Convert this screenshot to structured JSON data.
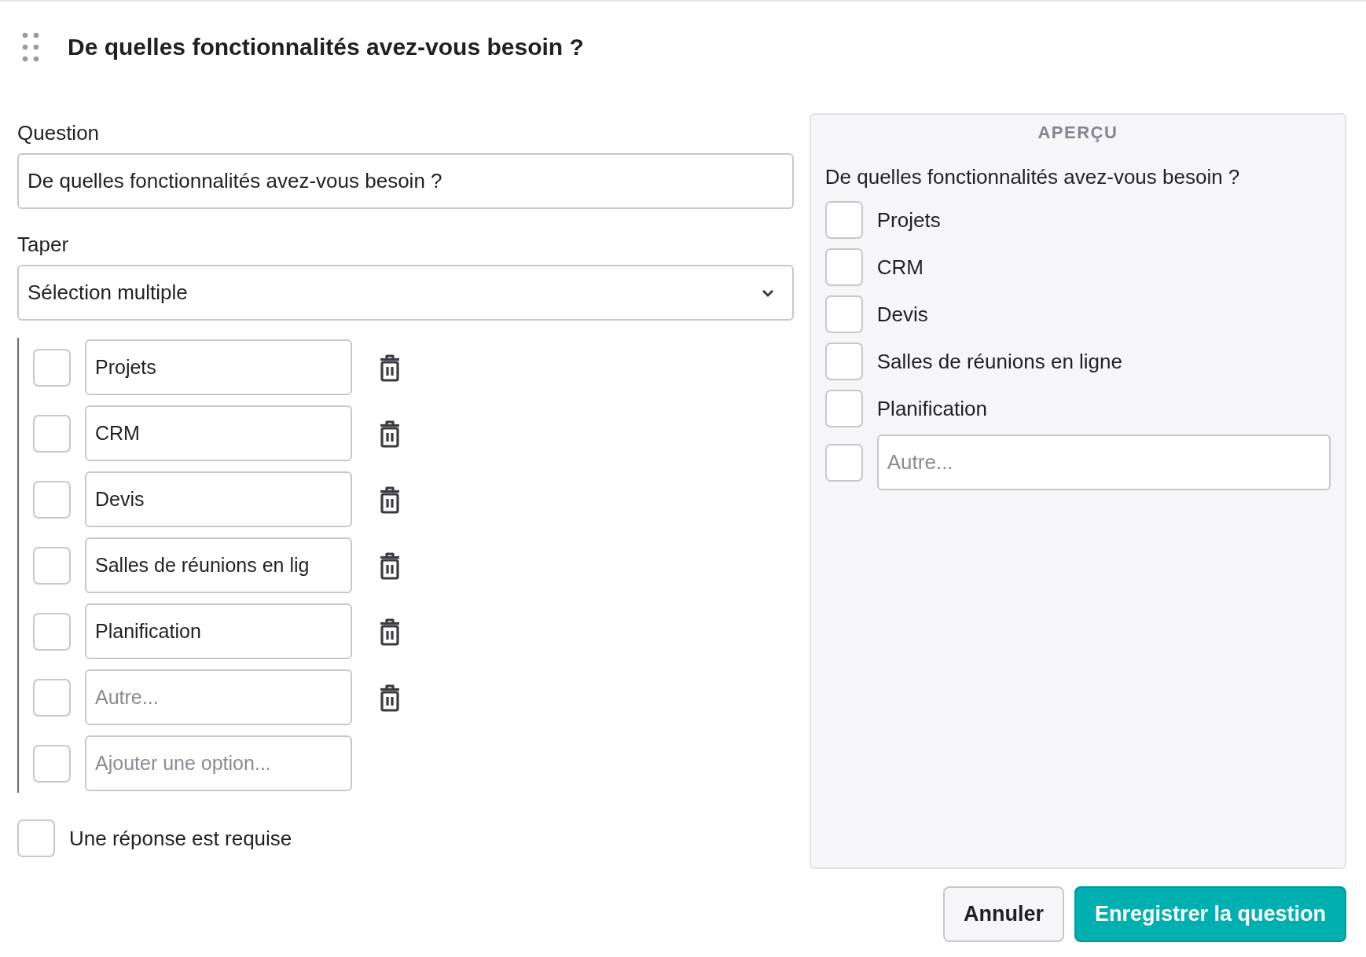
{
  "header": {
    "title": "De quelles fonctionnalités avez-vous besoin ?"
  },
  "question": {
    "label": "Question",
    "value": "De quelles fonctionnalités avez-vous besoin ?"
  },
  "type": {
    "label": "Taper",
    "value": "Sélection multiple"
  },
  "options": [
    {
      "value": "Projets",
      "checked": false,
      "deletable": true
    },
    {
      "value": "CRM",
      "checked": false,
      "deletable": true
    },
    {
      "value": "Devis",
      "checked": false,
      "deletable": true
    },
    {
      "value": "Salles de réunions en lig",
      "checked": false,
      "deletable": true
    },
    {
      "value": "Planification",
      "checked": false,
      "deletable": true
    },
    {
      "placeholder": "Autre...",
      "checked": false,
      "deletable": true
    },
    {
      "placeholder": "Ajouter une option...",
      "checked": false,
      "deletable": false
    }
  ],
  "required": {
    "label": "Une réponse est requise",
    "checked": false
  },
  "preview": {
    "heading": "APERÇU",
    "question": "De quelles fonctionnalités avez-vous besoin ?",
    "choices": [
      {
        "kind": "label",
        "label": "Projets",
        "checked": false
      },
      {
        "kind": "label",
        "label": "CRM",
        "checked": false
      },
      {
        "kind": "label",
        "label": "Devis",
        "checked": false
      },
      {
        "kind": "label",
        "label": "Salles de réunions en ligne",
        "checked": false
      },
      {
        "kind": "label",
        "label": "Planification",
        "checked": false
      },
      {
        "kind": "field",
        "placeholder": "Autre...",
        "checked": false
      }
    ]
  },
  "buttons": [
    {
      "label": "Annuler",
      "kind": "secondary"
    },
    {
      "label": "Enregistrer la question",
      "kind": "primary"
    }
  ]
}
